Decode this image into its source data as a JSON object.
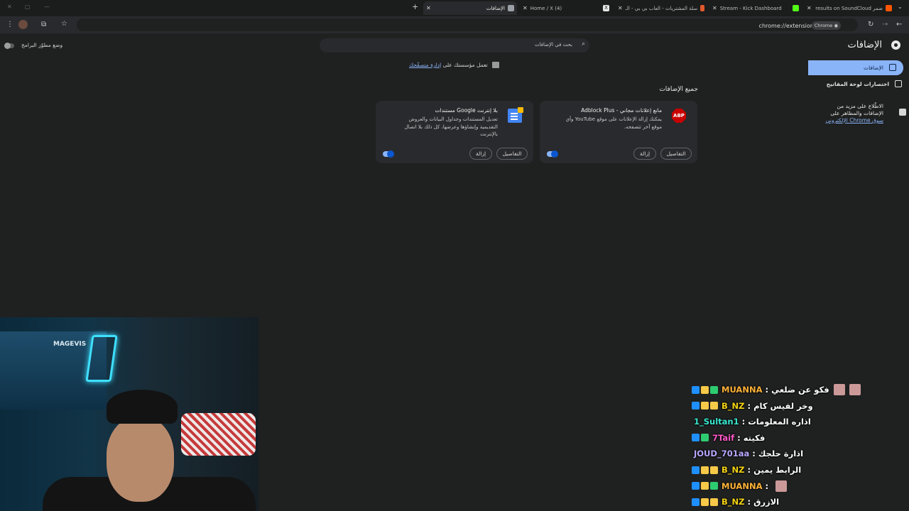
{
  "tabs": [
    {
      "label": "ضمر results on SoundCloud",
      "favicon_color": "#ff5500"
    },
    {
      "label": "Stream - Kick Dashboard",
      "favicon_color": "#53fc18"
    },
    {
      "label": "سلة المشتريات - العاب بي بي - الـ",
      "favicon_color": "#e05a2b"
    },
    {
      "label": "(4) Home / X",
      "favicon_color": "#e8e8e8"
    },
    {
      "label": "الإضافات",
      "favicon_color": "#9aa0a6"
    }
  ],
  "toolbar": {
    "url": "chrome://extensions",
    "chip": "Chrome"
  },
  "page": {
    "title": "الإضافات",
    "search_placeholder": "بحث في الإضافات",
    "developer_mode": "وضع مطوّر البرامج",
    "managed_prefix": "تعمل مؤسستك على",
    "managed_link": "إدارة متصفّحك",
    "all_extensions": "جميع الإضافات"
  },
  "sidebar": {
    "items": [
      {
        "label": "الإضافات"
      },
      {
        "label": "اختصارات لوحة المفاتيح"
      },
      {
        "line1": "الاطّلاع على مزيد من",
        "line2": "الإضافات والمظاهر على",
        "link": "سوق Chrome الإلكتروني"
      }
    ]
  },
  "extensions": [
    {
      "name": "Adblock Plus - مانع إعلانات مجاني",
      "description": "يمكنك إزالة الإعلانات على موقع YouTube وأي موقع آخر تتصفحه.",
      "details": "التفاصيل",
      "remove": "إزالة",
      "icon": "abp-icon",
      "icon_text": "ABP",
      "enabled": true
    },
    {
      "name": "مستندات Google بلا إنترنت",
      "description": "تعديل المستندات وجداول البيانات والعروض التقديمية وإنشاؤها وعرضها، كل ذلك بلا اتصال بالإنترنت",
      "details": "التفاصيل",
      "remove": "إزالة",
      "icon": "google-docs-icon",
      "enabled": true
    }
  ],
  "webcam": {
    "overlay_text": "MAGEVIS"
  },
  "chat": [
    {
      "user": "MUANNA",
      "color": "#ffb238",
      "text": "فكو عن ضلعي",
      "badges": [
        "#1f8fff",
        "#f7c948",
        "#2ecc71"
      ],
      "emotes": 2
    },
    {
      "user": "B_NZ",
      "color": "#f5d312",
      "text": "وخر لفيس كام",
      "badges": [
        "#1f8fff",
        "#f7c948",
        "#f7c948"
      ],
      "emotes": 0
    },
    {
      "user": "1_Sultan1",
      "color": "#38e8d0",
      "text": "اذاره المعلومات",
      "badges": [],
      "emotes": 0
    },
    {
      "user": "7Taif",
      "color": "#ff5ac8",
      "text": "فكيته",
      "badges": [
        "#1f8fff",
        "#2ecc71"
      ],
      "emotes": 0
    },
    {
      "user": "JOUD_701aa",
      "color": "#b9a7ff",
      "text": "اذارة حلجك",
      "badges": [],
      "emotes": 0
    },
    {
      "user": "B_NZ",
      "color": "#f5d312",
      "text": "الرابط يمين",
      "badges": [
        "#1f8fff",
        "#f7c948",
        "#f7c948"
      ],
      "emotes": 0
    },
    {
      "user": "MUANNA",
      "color": "#ffb238",
      "text": "",
      "badges": [
        "#1f8fff",
        "#f7c948",
        "#2ecc71"
      ],
      "emotes": 1
    },
    {
      "user": "B_NZ",
      "color": "#f5d312",
      "text": "الازرق",
      "badges": [
        "#1f8fff",
        "#f7c948",
        "#f7c948"
      ],
      "emotes": 0
    }
  ]
}
